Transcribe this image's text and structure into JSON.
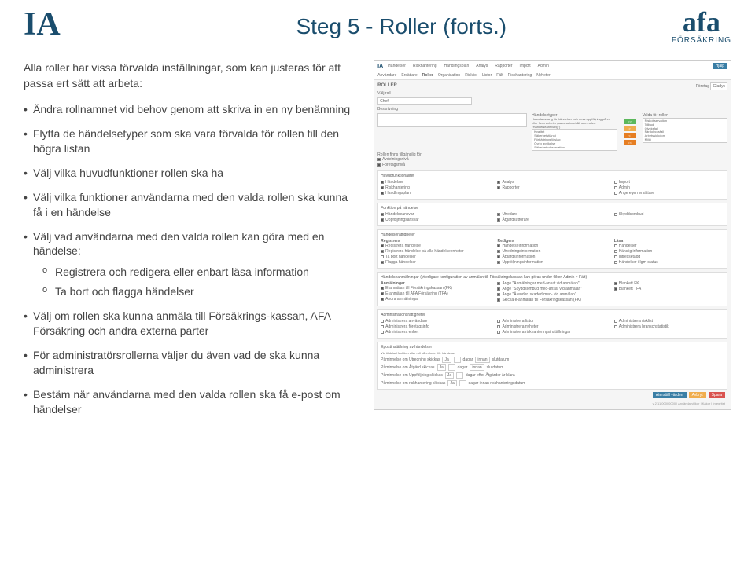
{
  "header": {
    "logo_left": "IA",
    "title": "Steg 5 - Roller (forts.)",
    "logo_right": "afa",
    "logo_right_sub": "FÖRSÄKRING"
  },
  "intro": "Alla roller har vissa förvalda inställningar, som kan justeras för att passa ert sätt att arbeta:",
  "bullets": [
    "Ändra rollnamnet vid behov genom att skriva in en ny benämning",
    "Flytta de händelsetyper som ska vara förvalda för rollen till den högra listan",
    "Välj vilka huvudfunktioner rollen ska ha",
    "Välj vilka funktioner användarna med den valda rollen ska kunna få i en händelse",
    "Välj vad användarna med den valda rollen kan göra med en händelse:"
  ],
  "sub_bullets": [
    "Registrera och redigera eller enbart läsa information",
    "Ta bort och flagga händelser"
  ],
  "bullets2": [
    "Välj om rollen ska kunna anmäla till Försäkrings-kassan, AFA Försäkring och andra externa parter",
    "För administratörsrollerna väljer du även vad de ska kunna administrera",
    "Bestäm när användarna med den valda rollen ska få e-post om händelser"
  ],
  "screenshot": {
    "topnav": [
      "Händelser",
      "Riskhantering",
      "Handlingsplan",
      "Analys",
      "Rapporter",
      "Import",
      "Admin"
    ],
    "hjalp": "Hjälp",
    "subnav": [
      "Användare",
      "Ersättare",
      "Roller",
      "Organisation",
      "Risklist",
      "Listor",
      "Fält",
      "Riskhantering",
      "Nyheter"
    ],
    "page_h": "ROLLER",
    "corp_label": "Företag",
    "corp_value": "Gladys",
    "valj_roll_label": "Välj roll",
    "roll_value": "Chef",
    "beskr_label": "Beskrivning",
    "ht_title": "Händelsetyper",
    "ht_desc": "Huvudansvarig för händelser och dess uppföljning på en eller flera enheter (samma innehåll som rollen \"Händelseansvarig\")",
    "ht_left_h": "Händelsetyper",
    "ht_left": [
      "Kvalitet",
      "Säkerhetstjänst",
      "Förbättringsförslag",
      "Övrig avvikelse",
      "Säkerhetsobservation"
    ],
    "ht_btn_addall": ">>",
    "ht_btn_add": ">",
    "ht_btn_rem": "<",
    "ht_btn_remall": "<<",
    "ht_right_h": "Valda för rollen",
    "ht_right": [
      "Riskobservation",
      "Tillbud",
      "Olycksfall",
      "Färdolycksfall",
      "Arbetssjukdom",
      "Miljö"
    ],
    "roll_override": "Rollen finns tillgänglig för",
    "roll_ov_opts": [
      "Avdelningsnivå",
      "Företagsnivå"
    ],
    "huvud_title": "Huvudfunktionalitet",
    "huvud_c1": [
      "Händelser",
      "Riskhantering",
      "Handlingsplan"
    ],
    "huvud_c2": [
      "Analys",
      "Rapporter"
    ],
    "huvud_c3": [
      "Import",
      "Admin",
      "Ange egen ersättare"
    ],
    "funk_title": "Funktion på händelse",
    "funk_c1": [
      "Händelseansvar",
      "Uppföljningsansvar"
    ],
    "funk_c2": [
      "Utredare",
      "Åtgärdsutförare"
    ],
    "funk_c3": [
      "Skyddsombud"
    ],
    "hratt_title": "Händelserättigheter",
    "hratt_h1": "Registrera",
    "hratt_c1": [
      "Registrera händelse",
      "Registrera händelse på alla händelseenheter",
      "Ta bort händelser",
      "Flagga händelser"
    ],
    "hratt_h2": "Redigera",
    "hratt_c2": [
      "Händelseinformation",
      "Utredningsinformation",
      "Åtgärdsinformation",
      "Uppföljningsinformation"
    ],
    "hratt_h3": "Läsa",
    "hratt_c3": [
      "Händelser",
      "Känslig information",
      "Intressetagg",
      "Händelser i Igm-status"
    ],
    "anm_title": "Händelseanmälningar (ytterligare konfiguration av anmälan till Försäkringskassan kan göras under fliken Admin > Fält)",
    "anm_h1": "Anmälningar",
    "anm_c1": [
      "E-anmälan till Försäkringskassan (FK)",
      "E-anmälan till AFA Försäkring (TFA)",
      "Andra anmälningar"
    ],
    "anm_h2": "",
    "anm_c2": [
      "Ange \"Anmälningar med-ansat vid anmälan\"",
      "Ange \"Skyddsombud med-ansat vid anmälan\"",
      "Ange \"Ärenden skaded med- vid anmälan\"",
      "Skicka e-anmälan till Försäkringskassan (FK)"
    ],
    "anm_h3": "",
    "anm_c3": [
      "Blankett FK",
      "Blankett TFA"
    ],
    "admin_title": "Administrationsrättigheter",
    "admin_c1": [
      "Administrera användare",
      "Administrera företagsinfo",
      "Administrera enhet"
    ],
    "admin_c2": [
      "Administrera listor",
      "Administrera nyheter",
      "Administrera riskhanteringsinställningar"
    ],
    "admin_c3": [
      "Administrera risklist",
      "Administrera branschstatistik"
    ],
    "epost_title": "Epostinställning av händelser",
    "epost_desc": "Vid tilldelad funktion eller roll på enheter för händelser",
    "epost_r1": "Påminnelse om Utredning skickas",
    "epost_r2": "Påminnelse om Åtgärd skickas",
    "epost_r3": "Påminnelse om Uppföljning skickas",
    "epost_r4": "Påminnelse om riskhantering skickas",
    "epost_ja": "Ja",
    "epost_dagar": "dagar",
    "epost_innan": "innan",
    "epost_slutdatum": "slutdatum",
    "epost_r3b": "dagar efter Åtgärder är klara",
    "epost_r4b": "dagar innan riskhanteringsdatum",
    "btn_aterstall": "Återställ värden",
    "btn_avbryt": "Avbryt",
    "btn_spara": "Spara",
    "footer": "v 2.11.00000000 | Användarvillkor | Kakor | Integritet"
  }
}
